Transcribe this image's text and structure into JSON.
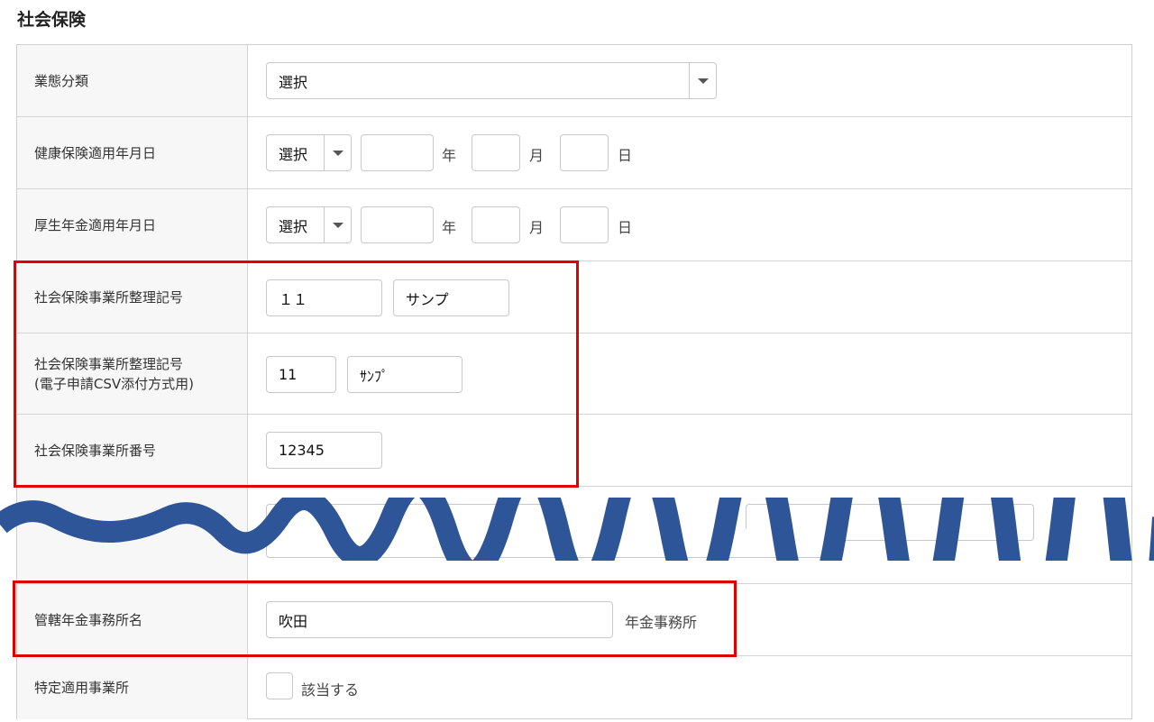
{
  "page_title": "社会保険",
  "rows": {
    "business_category": {
      "label": "業態分類",
      "select": "選択"
    },
    "health_date": {
      "label": "健康保険適用年月日",
      "era": "選択",
      "year_unit": "年",
      "month_unit": "月",
      "day_unit": "日"
    },
    "pension_date": {
      "label": "厚生年金適用年月日",
      "era": "選択",
      "year_unit": "年",
      "month_unit": "月",
      "day_unit": "日"
    },
    "office_code": {
      "label": "社会保険事業所整理記号",
      "value1": "１１",
      "value2": "サンプ"
    },
    "office_code_csv": {
      "label_line1": "社会保険事業所整理記号",
      "label_line2": "(電子申請CSV添付方式用)",
      "value1": "11",
      "value2": "ｻﾝﾌﾟ"
    },
    "office_number": {
      "label": "社会保険事業所番号",
      "value": "12345"
    },
    "pension_office": {
      "label": "管轄年金事務所名",
      "value": "吹田",
      "suffix": "年金事務所"
    },
    "specific_office": {
      "label": "特定適用事業所",
      "checkbox_label": "該当する",
      "checked": false
    }
  },
  "colors": {
    "highlight": "#e00000",
    "wave": "#2e5597"
  }
}
